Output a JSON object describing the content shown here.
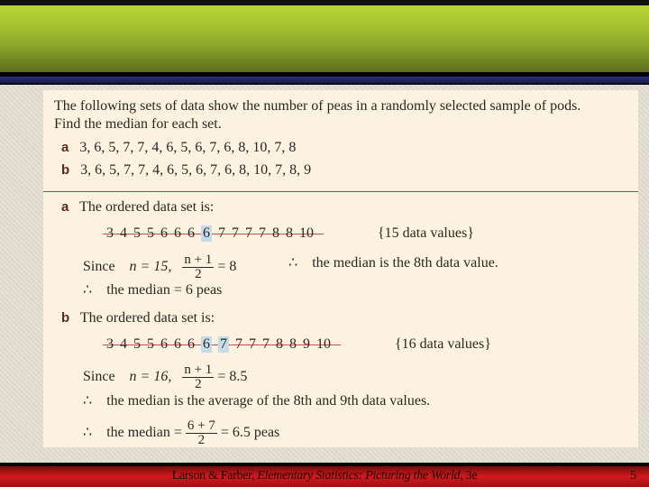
{
  "problem": {
    "line1": "The following sets of data show the number of peas in a randomly selected sample of pods.",
    "line2": "Find the median for each set.",
    "a_label": "a",
    "a_data": "3, 6, 5, 7, 7, 4, 6, 5, 6, 7, 6, 8, 10, 7, 8",
    "b_label": "b",
    "b_data": "3, 6, 5, 7, 7, 4, 6, 5, 6, 7, 6, 8, 10, 7, 8, 9"
  },
  "solution_a": {
    "label": "a",
    "heading": "The ordered data set is:",
    "ordered": [
      "3",
      "4",
      "5",
      "5",
      "6",
      "6",
      "6",
      "6",
      "7",
      "7",
      "7",
      "7",
      "8",
      "8",
      "10"
    ],
    "highlight_index": [
      7
    ],
    "count_note": "{15 data values}",
    "since": "Since",
    "n_eq": "n = 15,",
    "frac_num": "n + 1",
    "frac_den": "2",
    "frac_result": "= 8",
    "therefore": "∴",
    "conclusion1": "the median is the 8th data value.",
    "conclusion2": "the median = 6 peas"
  },
  "solution_b": {
    "label": "b",
    "heading": "The ordered data set is:",
    "ordered": [
      "3",
      "4",
      "5",
      "5",
      "6",
      "6",
      "6",
      "6",
      "7",
      "7",
      "7",
      "7",
      "8",
      "8",
      "9",
      "10"
    ],
    "highlight_index": [
      7,
      8
    ],
    "count_note": "{16 data values}",
    "since": "Since",
    "n_eq": "n = 16,",
    "frac_num": "n + 1",
    "frac_den": "2",
    "frac_result": "= 8.5",
    "therefore": "∴",
    "conclusion1": "the median is the average of the 8th and 9th data values.",
    "conclusion2_pre": "the median =",
    "frac2_num": "6 + 7",
    "frac2_den": "2",
    "conclusion2_post": "= 6.5 peas"
  },
  "footer": {
    "author": "Larson & Farber, ",
    "book": "Elementary Statistics: Picturing the World",
    "edition": ", 3e",
    "page": "5"
  }
}
